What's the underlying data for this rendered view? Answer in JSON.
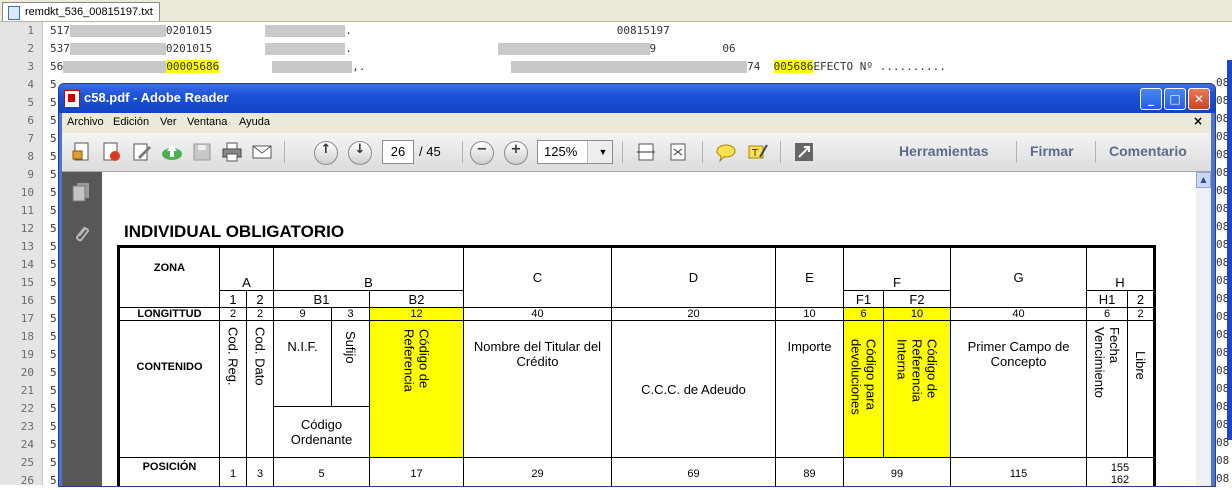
{
  "editor": {
    "tab": "remdkt_536_00815197.txt",
    "lines": [
      {
        "n": "1",
        "a": "517",
        "b": "0201015",
        "c": "00815197",
        "d": ""
      },
      {
        "n": "2",
        "a": "537",
        "b": "0201015",
        "c": "9",
        "d": "06"
      },
      {
        "n": "3",
        "a": "56",
        "b": "00005686",
        "c": "74",
        "d": "005686",
        "e": "EFECTO Nº .........."
      },
      {
        "n": "4",
        "a": "5"
      },
      {
        "n": "5",
        "a": "5"
      },
      {
        "n": "6",
        "a": "5"
      },
      {
        "n": "7",
        "a": "5"
      },
      {
        "n": "8",
        "a": "5"
      },
      {
        "n": "9",
        "a": "5"
      },
      {
        "n": "10",
        "a": "5"
      },
      {
        "n": "11",
        "a": "5"
      },
      {
        "n": "12",
        "a": "5"
      },
      {
        "n": "13",
        "a": "5"
      },
      {
        "n": "14",
        "a": "5"
      },
      {
        "n": "15",
        "a": "5"
      },
      {
        "n": "16",
        "a": "5"
      },
      {
        "n": "17",
        "a": "5"
      },
      {
        "n": "18",
        "a": "5"
      },
      {
        "n": "19",
        "a": "5"
      },
      {
        "n": "20",
        "a": "5"
      },
      {
        "n": "21",
        "a": "5"
      },
      {
        "n": "22",
        "a": "5"
      },
      {
        "n": "23",
        "a": "5"
      },
      {
        "n": "24",
        "a": "5"
      },
      {
        "n": "25",
        "a": "5"
      },
      {
        "n": "26",
        "a": "5"
      }
    ],
    "right_col": [
      "08",
      "08",
      "08",
      "08",
      "08",
      "08",
      "08",
      "08",
      "08",
      "08",
      "08",
      "08",
      "08",
      "08",
      "08",
      "08",
      "08",
      "08",
      "08",
      "08",
      "08",
      "08",
      "08",
      "08",
      "08"
    ]
  },
  "window": {
    "title": "c58.pdf - Adobe Reader",
    "menu": [
      "Archivo",
      "Edición",
      "Ver",
      "Ventana",
      "Ayuda"
    ],
    "page_current": "26",
    "page_total": "/ 45",
    "zoom": "125%",
    "right_tools": [
      "Herramientas",
      "Firmar",
      "Comentario"
    ],
    "controls": {
      "minimize": "_",
      "maximize": "□",
      "close": "✕",
      "menu_close": "×"
    }
  },
  "doc": {
    "title": "INDIVIDUAL OBLIGATORIO",
    "row_headers": {
      "zona": "ZONA",
      "longitud": "LONGITTUD",
      "contenido": "CONTENIDO",
      "posicion": "POSICIÓN"
    },
    "zones": {
      "A": "A",
      "B": "B",
      "C": "C",
      "D": "D",
      "E": "E",
      "F": "F",
      "G": "G",
      "H": "H"
    },
    "sub": {
      "a1": "1",
      "a2": "2",
      "b1": "B1",
      "b2": "B2",
      "f1": "F1",
      "f2": "F2",
      "h1": "H1",
      "h2": "2"
    },
    "lengths": {
      "a1": "2",
      "a2": "2",
      "b1a": "9",
      "b1b": "3",
      "b2": "12",
      "c": "40",
      "d": "20",
      "e": "10",
      "f1": "6",
      "f2": "10",
      "g": "40",
      "h1": "6",
      "h2": "2"
    },
    "content": {
      "cod_reg": "Cod. Reg.",
      "cod_dato": "Cod. Dato",
      "nif": "N.I.F.",
      "sufijo": "Sufijo",
      "cod_ordenante": "Código Ordenante",
      "cod_referencia": "Código de Referencia",
      "nombre_titular": "Nombre del Titular del Crédito",
      "ccc": "C.C.C. de Adeudo",
      "importe": "Importe",
      "cod_devoluciones": "Código para devoluciones",
      "cod_ref_interna": "Código de Referencia Interna",
      "primer_campo": "Primer Campo de Concepto",
      "fecha_venc": "Fecha Vencimiento",
      "libre": "Libre"
    },
    "positions": {
      "a1": "1",
      "a2": "3",
      "b1": "5",
      "b2": "17",
      "c": "29",
      "d": "69",
      "e": "89",
      "f": "99",
      "g": "115",
      "h1": "155",
      "h1b": "162"
    }
  }
}
